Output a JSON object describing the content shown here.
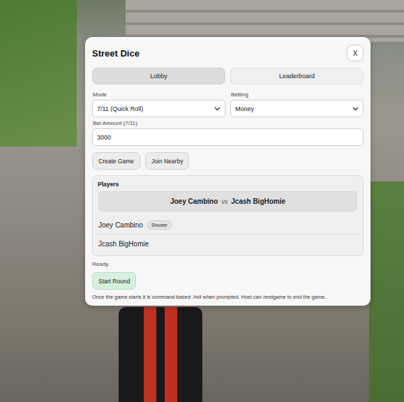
{
  "window": {
    "title": "Street Dice",
    "close": "X"
  },
  "tabs": [
    {
      "label": "Lobby",
      "selected": true
    },
    {
      "label": "Leaderboard",
      "selected": false
    }
  ],
  "fields": {
    "mode": {
      "label": "Mode",
      "value": "7/11 (Quick Roll)"
    },
    "betting": {
      "label": "Betting",
      "value": "Money"
    },
    "bet_amount": {
      "label": "Bet Amount (7/11)",
      "value": "3000"
    }
  },
  "buttons": [
    "Create Game",
    "Join Nearby"
  ],
  "players": {
    "title": "Players",
    "matchup": {
      "left": "Joey Cambino",
      "vs": "vs",
      "right": "Jcash BigHomie"
    },
    "list": [
      {
        "name": "Joey Cambino",
        "badges": [
          "Shooter"
        ]
      },
      {
        "name": "Jcash BigHomie",
        "badges": []
      }
    ]
  },
  "status": "Ready.",
  "start_button": "Start Round",
  "footer": "Once the game starts it is command based: /roll when prompted. Host can /endgame to end the game.."
}
